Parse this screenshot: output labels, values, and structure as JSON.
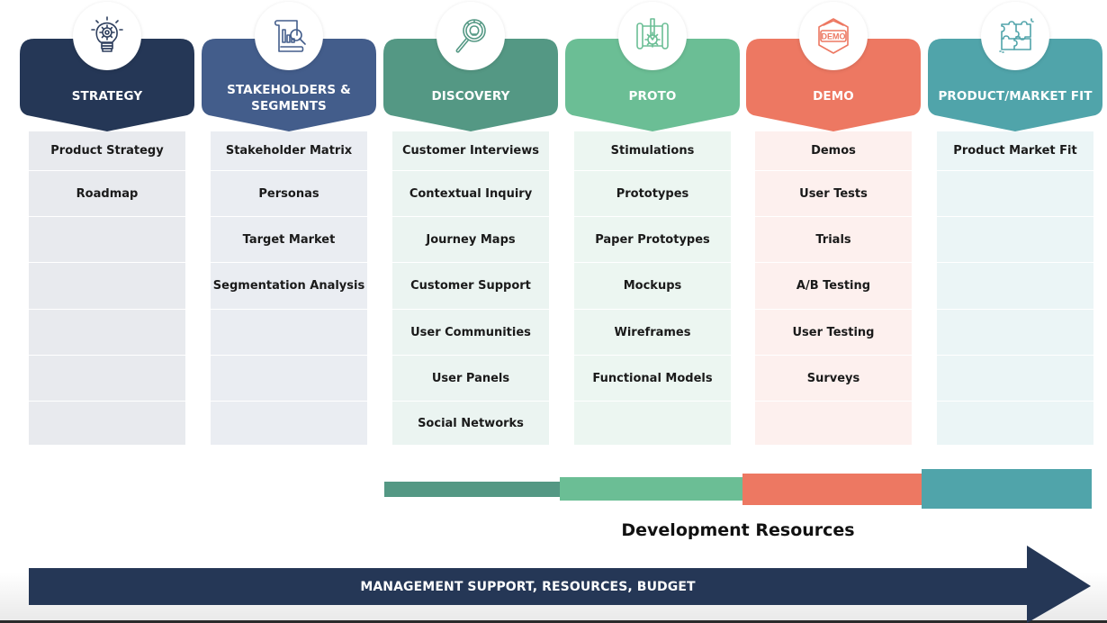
{
  "columns": [
    {
      "id": "strategy",
      "title_lines": [
        "STRATEGY"
      ],
      "icon": "lightbulb-gear-icon",
      "header_color": "#253756",
      "icon_color": "#2e3f5e",
      "cell_bg": "#e8eaee",
      "items": [
        "Product Strategy",
        "Roadmap",
        "",
        "",
        "",
        "",
        ""
      ]
    },
    {
      "id": "stakeholders-segments",
      "title_lines": [
        "STAKEHOLDERS &",
        "SEGMENTS"
      ],
      "icon": "report-magnifier-icon",
      "header_color": "#435d8b",
      "icon_color": "#435d8b",
      "cell_bg": "#eaedf2",
      "items": [
        "Stakeholder Matrix",
        "Personas",
        "Target Market",
        "Segmentation Analysis",
        "",
        "",
        ""
      ]
    },
    {
      "id": "discovery",
      "title_lines": [
        "DISCOVERY"
      ],
      "icon": "magnifier-lightbulb-icon",
      "header_color": "#549884",
      "icon_color": "#549884",
      "cell_bg": "#ebf4f1",
      "items": [
        "Customer Interviews",
        "Contextual Inquiry",
        "Journey Maps",
        "Customer Support",
        "User Communities",
        "User Panels",
        "Social Networks"
      ]
    },
    {
      "id": "proto",
      "title_lines": [
        "PROTO"
      ],
      "icon": "blueprint-gear-icon",
      "header_color": "#6bbe95",
      "icon_color": "#6bbe95",
      "cell_bg": "#ecf6f1",
      "items": [
        "Stimulations",
        "Prototypes",
        "Paper Prototypes",
        "Mockups",
        "Wireframes",
        "Functional Models",
        ""
      ]
    },
    {
      "id": "demo",
      "title_lines": [
        "DEMO"
      ],
      "icon": "demo-hexagon-icon",
      "icon_text": "DEMO",
      "header_color": "#ed7862",
      "icon_color": "#ed7862",
      "cell_bg": "#fdf0ee",
      "items": [
        "Demos",
        "User Tests",
        "Trials",
        "A/B Testing",
        "User Testing",
        "Surveys",
        ""
      ]
    },
    {
      "id": "product-market-fit",
      "title_lines": [
        "PRODUCT/MARKET FIT"
      ],
      "icon": "puzzle-pieces-icon",
      "header_color": "#50a4aa",
      "icon_color": "#50a4aa",
      "cell_bg": "#ebf5f6",
      "items": [
        "Product Market Fit",
        "",
        "",
        "",
        "",
        "",
        ""
      ]
    }
  ],
  "development_resources": {
    "label": "Development Resources",
    "segments": [
      {
        "stage": "discovery",
        "relative_level": 1,
        "color": "#549884"
      },
      {
        "stage": "proto",
        "relative_level": 2,
        "color": "#6bbe95"
      },
      {
        "stage": "demo",
        "relative_level": 3,
        "color": "#ed7862"
      },
      {
        "stage": "product-market-fit",
        "relative_level": 4,
        "color": "#50a4aa"
      }
    ]
  },
  "management_arrow": {
    "label": "MANAGEMENT SUPPORT, RESOURCES, BUDGET",
    "color": "#253756"
  }
}
